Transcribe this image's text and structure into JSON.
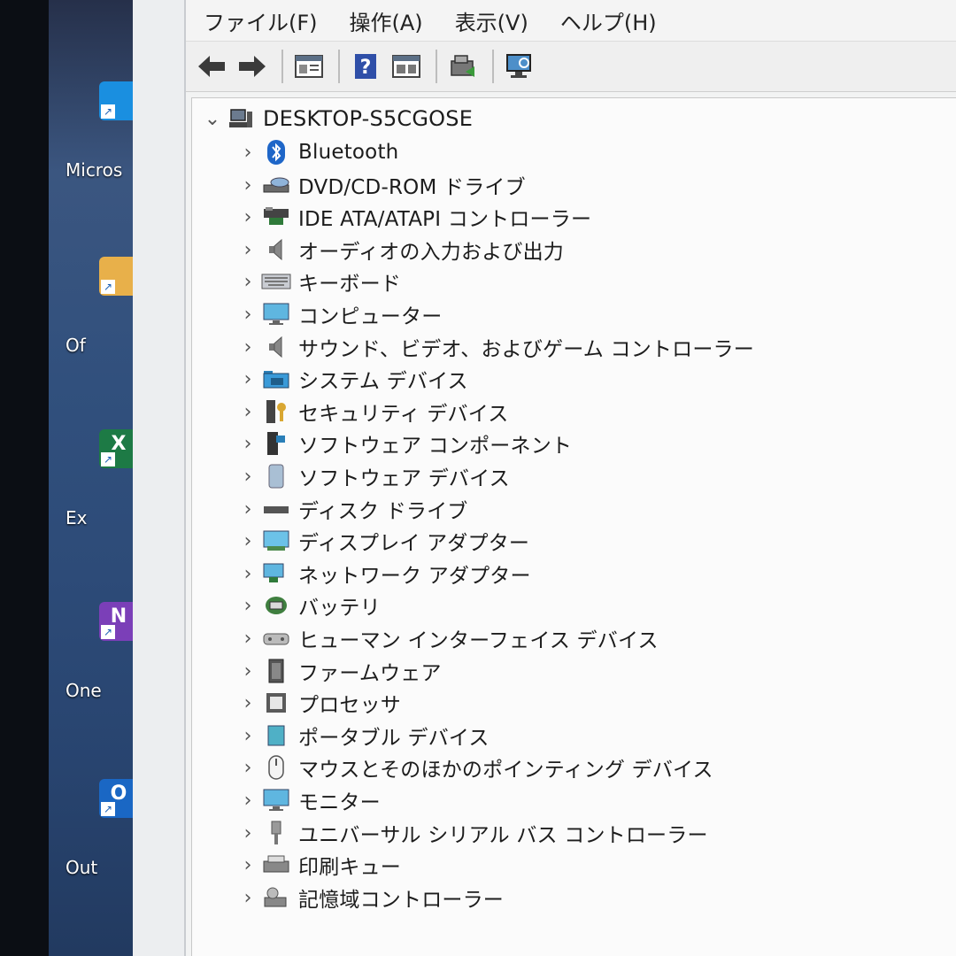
{
  "desktop": {
    "icons": [
      {
        "label": "Micros",
        "letter": "",
        "color": "#1a8fe0"
      },
      {
        "label": "Of",
        "letter": "",
        "color": "#e8b04a"
      },
      {
        "label": "Ex",
        "letter": "X",
        "color": "#1d7a45"
      },
      {
        "label": "One",
        "letter": "N",
        "color": "#7b3fb8"
      },
      {
        "label": "Out",
        "letter": "O",
        "color": "#1a67c4"
      }
    ]
  },
  "menu": [
    "ファイル(F)",
    "操作(A)",
    "表示(V)",
    "ヘルプ(H)"
  ],
  "toolbar": [
    "back-icon",
    "forward-icon",
    "properties-icon",
    "help-icon",
    "view-icon",
    "update-driver-icon",
    "scan-hardware-icon"
  ],
  "tree": {
    "root": {
      "label": "DESKTOP-S5CGOSE",
      "icon": "computer-icon"
    },
    "items": [
      {
        "label": "Bluetooth",
        "icon": "bluetooth-icon"
      },
      {
        "label": "DVD/CD-ROM ドライブ",
        "icon": "dvd-drive-icon"
      },
      {
        "label": "IDE ATA/ATAPI コントローラー",
        "icon": "ide-controller-icon"
      },
      {
        "label": "オーディオの入力および出力",
        "icon": "speaker-icon"
      },
      {
        "label": "キーボード",
        "icon": "keyboard-icon"
      },
      {
        "label": "コンピューター",
        "icon": "monitor-icon"
      },
      {
        "label": "サウンド、ビデオ、およびゲーム コントローラー",
        "icon": "speaker-icon"
      },
      {
        "label": "システム デバイス",
        "icon": "system-folder-icon"
      },
      {
        "label": "セキュリティ デバイス",
        "icon": "security-key-icon"
      },
      {
        "label": "ソフトウェア コンポーネント",
        "icon": "software-component-icon"
      },
      {
        "label": "ソフトウェア デバイス",
        "icon": "software-device-icon"
      },
      {
        "label": "ディスク ドライブ",
        "icon": "disk-drive-icon"
      },
      {
        "label": "ディスプレイ アダプター",
        "icon": "display-adapter-icon"
      },
      {
        "label": "ネットワーク アダプター",
        "icon": "network-adapter-icon"
      },
      {
        "label": "バッテリ",
        "icon": "battery-icon"
      },
      {
        "label": "ヒューマン インターフェイス デバイス",
        "icon": "hid-icon"
      },
      {
        "label": "ファームウェア",
        "icon": "firmware-icon"
      },
      {
        "label": "プロセッサ",
        "icon": "processor-icon"
      },
      {
        "label": "ポータブル デバイス",
        "icon": "portable-device-icon"
      },
      {
        "label": "マウスとそのほかのポインティング デバイス",
        "icon": "mouse-icon"
      },
      {
        "label": "モニター",
        "icon": "monitor-icon"
      },
      {
        "label": "ユニバーサル シリアル バス コントローラー",
        "icon": "usb-icon"
      },
      {
        "label": "印刷キュー",
        "icon": "printer-icon"
      },
      {
        "label": "記憶域コントローラー",
        "icon": "storage-controller-icon"
      }
    ]
  }
}
